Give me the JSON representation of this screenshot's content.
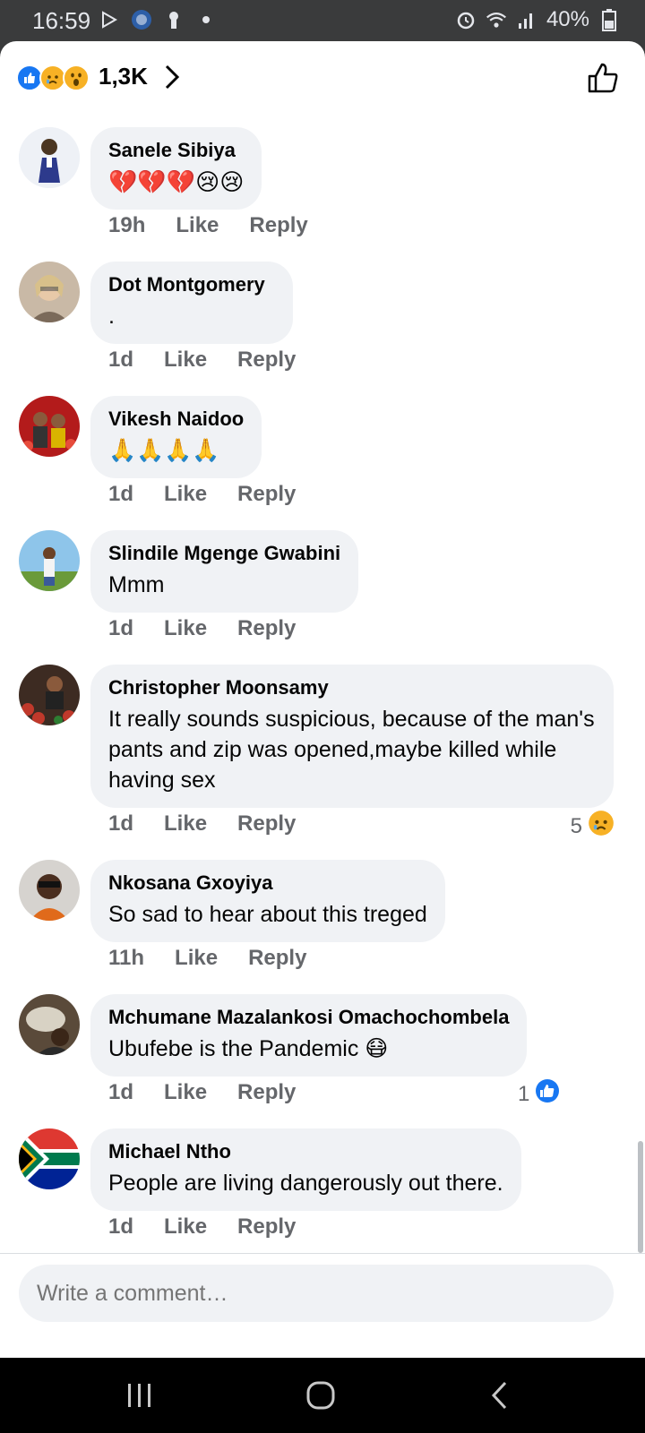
{
  "status_bar": {
    "time": "16:59",
    "battery": "40%",
    "icons_left": [
      "play-store-icon",
      "news-app-icon",
      "keyhole-icon",
      "dot-icon"
    ],
    "icons_right": [
      "alarm-icon",
      "wifi-icon",
      "signal-icon",
      "battery-icon"
    ]
  },
  "reactions": {
    "types": [
      "like",
      "sad",
      "wow"
    ],
    "count": "1,3K"
  },
  "comments": [
    {
      "author": "Sanele Sibiya",
      "text": "💔💔💔😢😢",
      "time": "19h",
      "like": "Like",
      "reply": "Reply"
    },
    {
      "author": "Dot Montgomery",
      "text": ".",
      "time": "1d",
      "like": "Like",
      "reply": "Reply"
    },
    {
      "author": "Vikesh Naidoo",
      "text": "🙏🙏🙏🙏",
      "time": "1d",
      "like": "Like",
      "reply": "Reply"
    },
    {
      "author": "Slindile Mgenge Gwabini",
      "text": "Mmm",
      "time": "1d",
      "like": "Like",
      "reply": "Reply"
    },
    {
      "author": "Christopher Moonsamy",
      "text": "It really sounds suspicious, because of the man's pants and zip was opened,maybe killed while having sex",
      "time": "1d",
      "like": "Like",
      "reply": "Reply",
      "reaction_count": "5",
      "reaction_type": "sad"
    },
    {
      "author": "Nkosana Gxoyiya",
      "text": "So sad to hear about this treged",
      "time": "11h",
      "like": "Like",
      "reply": "Reply"
    },
    {
      "author": "Mchumane Mazalankosi Omachochombela",
      "text": "Ubufebe is the Pandemic 😷",
      "time": "1d",
      "like": "Like",
      "reply": "Reply",
      "reaction_count": "1",
      "reaction_type": "like"
    },
    {
      "author": "Michael Ntho",
      "text": "People are living dangerously out there.",
      "time": "1d",
      "like": "Like",
      "reply": "Reply"
    }
  ],
  "composer": {
    "placeholder": "Write a comment…"
  },
  "colors": {
    "facebook_blue": "#1877f2",
    "bubble_bg": "#f0f2f5",
    "meta_text": "#65676b",
    "reaction_yellow": "#f7b125"
  }
}
